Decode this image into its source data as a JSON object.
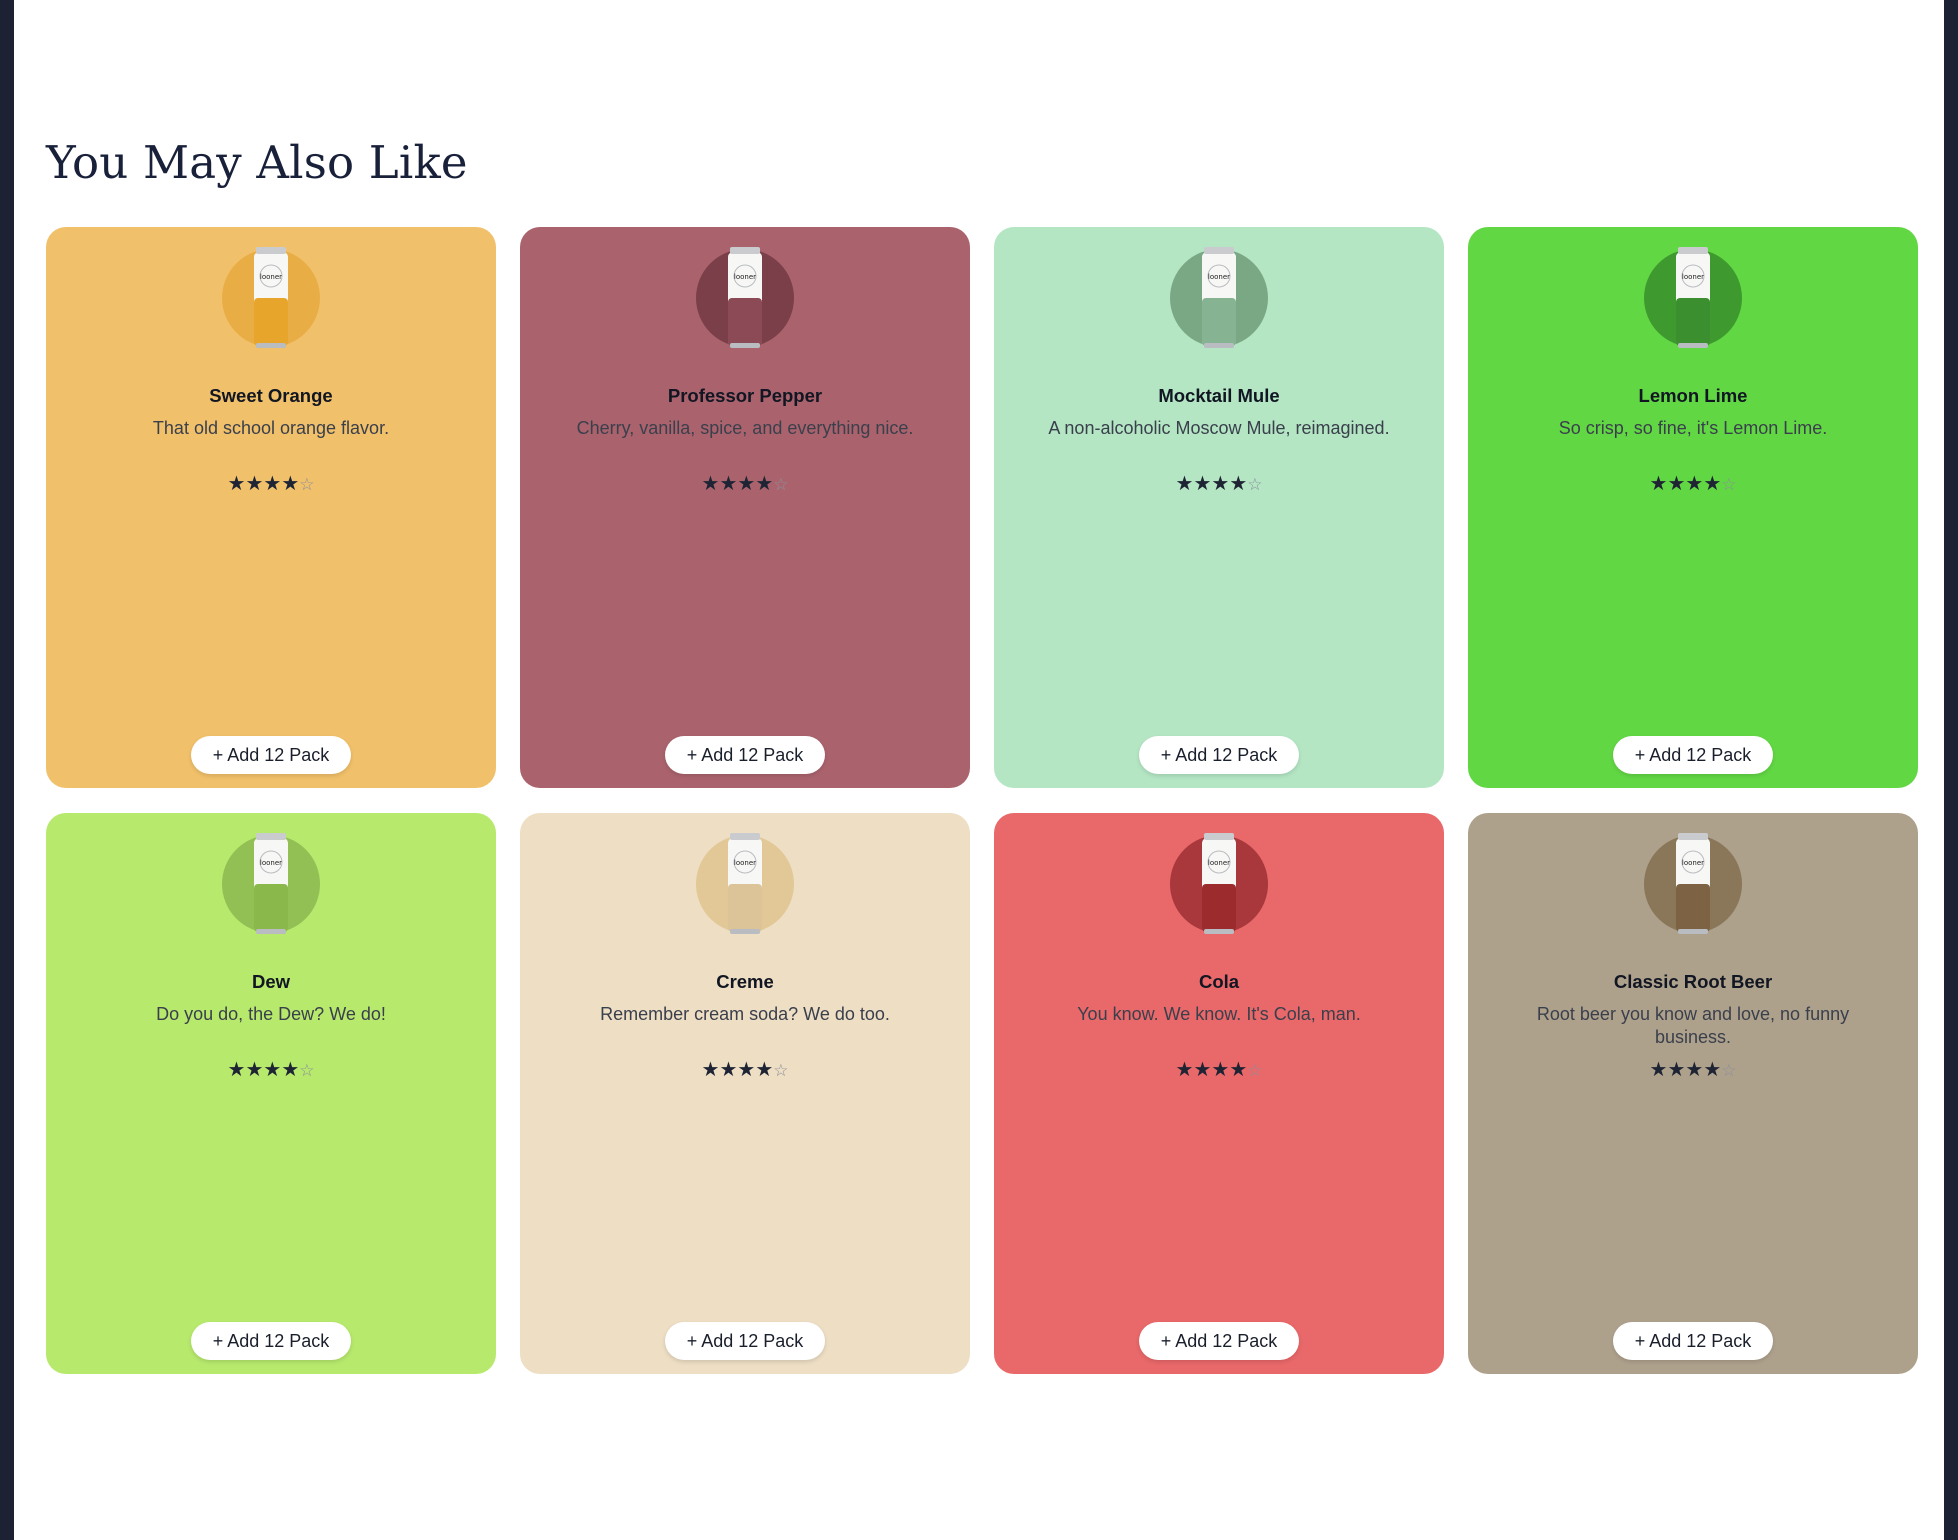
{
  "section": {
    "title": "You May Also Like"
  },
  "products": [
    {
      "name": "Sweet Orange",
      "description": "That old school orange flavor.",
      "rating": 4,
      "rating_max": 5,
      "card_color": "#f1c06a",
      "circle_color": "#e9ad46",
      "liquid_color": "#e7a52c",
      "button_label": "+ Add 12 Pack"
    },
    {
      "name": "Professor Pepper",
      "description": "Cherry, vanilla, spice, and everything nice.",
      "rating": 4,
      "rating_max": 5,
      "card_color": "#aa636d",
      "circle_color": "#7a3f48",
      "liquid_color": "#8b4a55",
      "button_label": "+ Add 12 Pack"
    },
    {
      "name": "Mocktail Mule",
      "description": "A non-alcoholic Moscow Mule, reimagined.",
      "rating": 4,
      "rating_max": 5,
      "card_color": "#b4e6c4",
      "circle_color": "#7aa885",
      "liquid_color": "#86b493",
      "button_label": "+ Add 12 Pack"
    },
    {
      "name": "Lemon Lime",
      "description": "So crisp, so fine, it's Lemon Lime.",
      "rating": 4,
      "rating_max": 5,
      "card_color": "#62d744",
      "circle_color": "#3e9a2f",
      "liquid_color": "#3c8f2f",
      "button_label": "+ Add 12 Pack"
    },
    {
      "name": "Dew",
      "description": "Do you do, the Dew? We do!",
      "rating": 4,
      "rating_max": 5,
      "card_color": "#b7e96d",
      "circle_color": "#93c054",
      "liquid_color": "#8bb84a",
      "button_label": "+ Add 12 Pack"
    },
    {
      "name": "Creme",
      "description": "Remember cream soda? We do too.",
      "rating": 4,
      "rating_max": 5,
      "card_color": "#eddec4",
      "circle_color": "#e2c896",
      "liquid_color": "#dcc398",
      "button_label": "+ Add 12 Pack"
    },
    {
      "name": "Cola",
      "description": "You know. We know. It's Cola, man.",
      "rating": 4,
      "rating_max": 5,
      "card_color": "#e96869",
      "circle_color": "#a8383b",
      "liquid_color": "#9c2b2e",
      "button_label": "+ Add 12 Pack"
    },
    {
      "name": "Classic Root Beer",
      "description": "Root beer you know and love, no funny business.",
      "rating": 4,
      "rating_max": 5,
      "card_color": "#aea18c",
      "circle_color": "#8a7658",
      "liquid_color": "#7d6344",
      "button_label": "+ Add 12 Pack"
    }
  ],
  "can_brand": "looner"
}
